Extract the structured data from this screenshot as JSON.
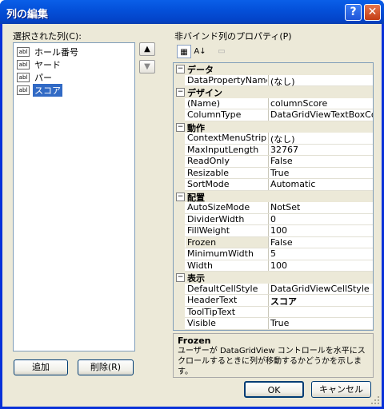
{
  "window": {
    "title": "列の編集",
    "help_icon": "?",
    "close_icon": "✕"
  },
  "left": {
    "label": "選択された列(C):",
    "columns": [
      {
        "icon": "abl",
        "label": "ホール番号"
      },
      {
        "icon": "abl",
        "label": "ヤード"
      },
      {
        "icon": "abl",
        "label": "パー"
      },
      {
        "icon": "abl",
        "label": "スコア",
        "selected": true
      }
    ],
    "add_label": "追加",
    "remove_label": "削除(R)"
  },
  "right": {
    "label": "非バインド列のプロパティ(P)",
    "categories": [
      {
        "name": "データ",
        "props": [
          [
            "DataPropertyName",
            "(なし)"
          ]
        ]
      },
      {
        "name": "デザイン",
        "props": [
          [
            "(Name)",
            "columnScore"
          ],
          [
            "ColumnType",
            "DataGridViewTextBoxColu"
          ]
        ]
      },
      {
        "name": "動作",
        "props": [
          [
            "ContextMenuStrip",
            "(なし)"
          ],
          [
            "MaxInputLength",
            "32767"
          ],
          [
            "ReadOnly",
            "False"
          ],
          [
            "Resizable",
            "True"
          ],
          [
            "SortMode",
            "Automatic"
          ]
        ]
      },
      {
        "name": "配置",
        "props": [
          [
            "AutoSizeMode",
            "NotSet"
          ],
          [
            "DividerWidth",
            "0"
          ],
          [
            "FillWeight",
            "100"
          ],
          [
            "Frozen",
            "False"
          ],
          [
            "MinimumWidth",
            "5"
          ],
          [
            "Width",
            "100"
          ]
        ]
      },
      {
        "name": "表示",
        "props": [
          [
            "DefaultCellStyle",
            "DataGridViewCellStyle { }"
          ],
          [
            "HeaderText",
            "スコア"
          ],
          [
            "ToolTipText",
            ""
          ],
          [
            "Visible",
            "True"
          ]
        ]
      }
    ],
    "selected_property": "Frozen",
    "description_title": "Frozen",
    "description_text": "ユーザーが DataGridView コントロールを水平にスクロールするときに列が移動するかどうかを示します。"
  },
  "footer": {
    "ok_label": "OK",
    "cancel_label": "キャンセル"
  }
}
